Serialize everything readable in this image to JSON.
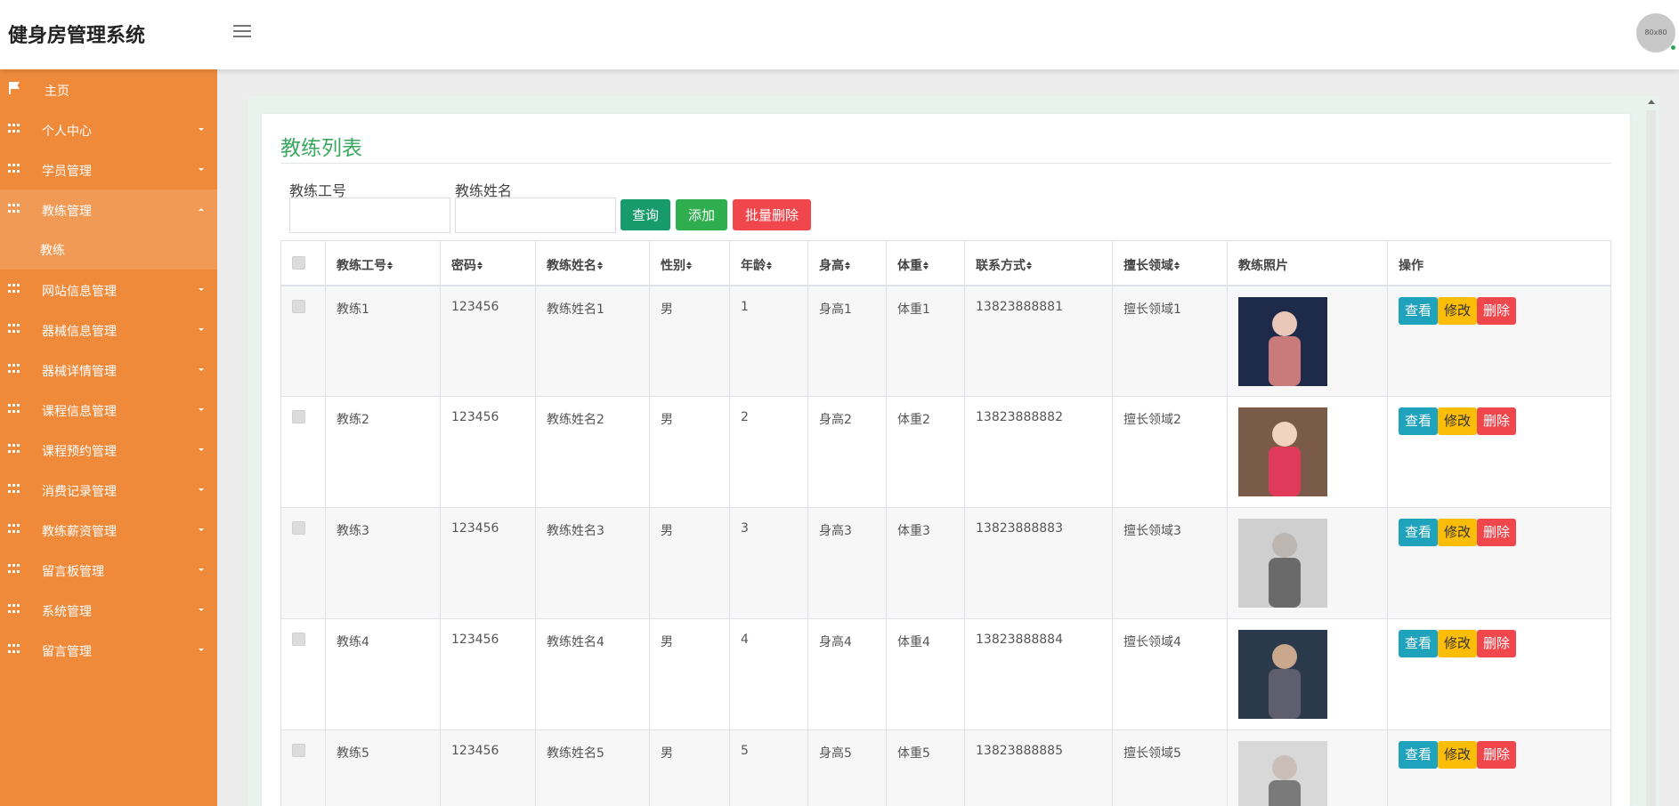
{
  "header": {
    "title": "健身房管理系统",
    "avatar_text": "80x80"
  },
  "sidebar": {
    "items": [
      {
        "label": "主页",
        "icon": "flag-icon"
      },
      {
        "label": "个人中心",
        "icon": "grid-icon"
      },
      {
        "label": "学员管理",
        "icon": "grid-icon"
      },
      {
        "label": "教练管理",
        "icon": "grid-icon",
        "expanded": true,
        "sub": "教练"
      },
      {
        "label": "网站信息管理",
        "icon": "grid-icon"
      },
      {
        "label": "器械信息管理",
        "icon": "grid-icon"
      },
      {
        "label": "器械详情管理",
        "icon": "grid-icon"
      },
      {
        "label": "课程信息管理",
        "icon": "grid-icon"
      },
      {
        "label": "课程预约管理",
        "icon": "grid-icon"
      },
      {
        "label": "消费记录管理",
        "icon": "grid-icon"
      },
      {
        "label": "教练薪资管理",
        "icon": "grid-icon"
      },
      {
        "label": "留言板管理",
        "icon": "grid-icon"
      },
      {
        "label": "系统管理",
        "icon": "grid-icon"
      },
      {
        "label": "留言管理",
        "icon": "grid-icon"
      }
    ]
  },
  "main": {
    "title": "教练列表",
    "search": {
      "id_label": "教练工号",
      "id_value": "",
      "id_placeholder": "",
      "name_label": "教练姓名",
      "name_value": "",
      "name_placeholder": ""
    },
    "buttons": {
      "query": "查询",
      "add": "添加",
      "batch_delete": "批量删除"
    },
    "table": {
      "headers": [
        "教练工号",
        "密码",
        "教练姓名",
        "性别",
        "年龄",
        "身高",
        "体重",
        "联系方式",
        "擅长领域",
        "教练照片",
        "操作"
      ],
      "rows": [
        {
          "id": "教练1",
          "password": "123456",
          "name": "教练姓名1",
          "gender": "男",
          "age": "1",
          "height": "身高1",
          "weight": "体重1",
          "phone": "13823888881",
          "specialty": "擅长领域1"
        },
        {
          "id": "教练2",
          "password": "123456",
          "name": "教练姓名2",
          "gender": "男",
          "age": "2",
          "height": "身高2",
          "weight": "体重2",
          "phone": "13823888882",
          "specialty": "擅长领域2"
        },
        {
          "id": "教练3",
          "password": "123456",
          "name": "教练姓名3",
          "gender": "男",
          "age": "3",
          "height": "身高3",
          "weight": "体重3",
          "phone": "13823888883",
          "specialty": "擅长领域3"
        },
        {
          "id": "教练4",
          "password": "123456",
          "name": "教练姓名4",
          "gender": "男",
          "age": "4",
          "height": "身高4",
          "weight": "体重4",
          "phone": "13823888884",
          "specialty": "擅长领域4"
        },
        {
          "id": "教练5",
          "password": "123456",
          "name": "教练姓名5",
          "gender": "男",
          "age": "5",
          "height": "身高5",
          "weight": "体重5",
          "phone": "13823888885",
          "specialty": "擅长领域5"
        }
      ],
      "actions": {
        "view": "查看",
        "edit": "修改",
        "delete": "删除"
      }
    }
  },
  "colors": {
    "sidebar": "#ef8a3b",
    "sidebar_active": "#f09a55",
    "title": "#3aa860",
    "view": "#1fa3bd",
    "edit": "#fbbd08",
    "delete": "#f0474d"
  }
}
